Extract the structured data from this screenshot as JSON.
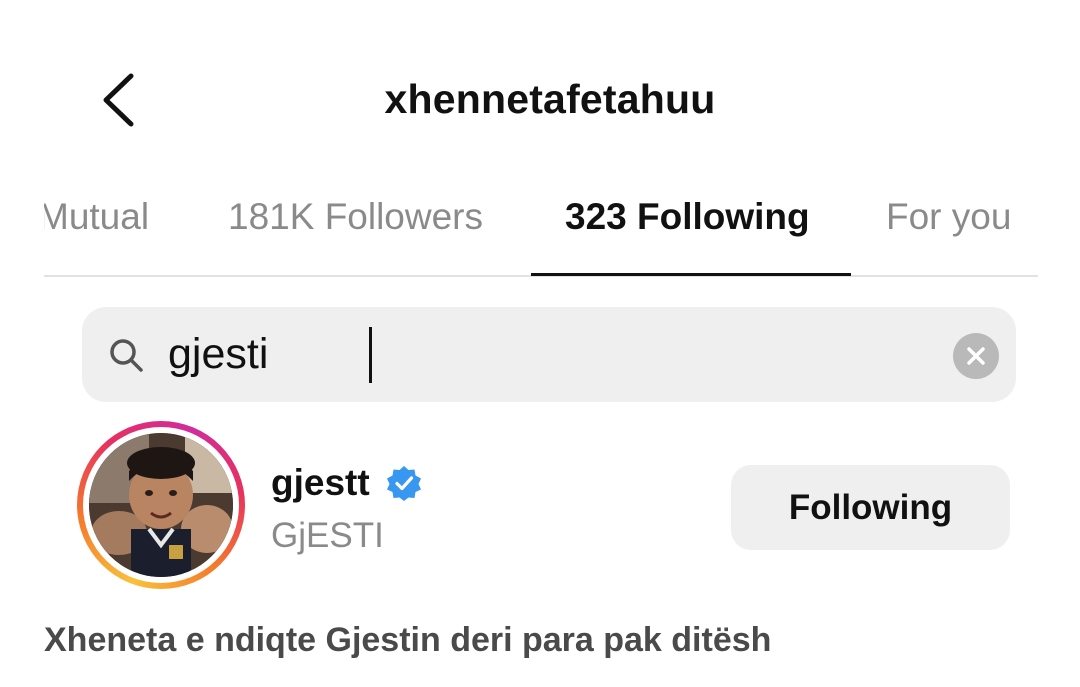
{
  "header": {
    "title": "xhennetafetahuu",
    "back_icon": "chevron-left-icon"
  },
  "tabs": [
    {
      "label": "Mutual",
      "active": false
    },
    {
      "label": "181K Followers",
      "active": false
    },
    {
      "label": "323 Following",
      "active": true
    },
    {
      "label": "For you",
      "active": false
    }
  ],
  "search": {
    "value": "gjesti",
    "icon": "search-icon",
    "clear_icon": "clear-icon"
  },
  "result": {
    "username": "gjestt",
    "verified": true,
    "full_name": "GjESTI",
    "button_label": "Following",
    "story_ring": true
  },
  "caption": "Xheneta e ndiqte Gjestin deri para pak ditësh",
  "colors": {
    "text_primary": "#111111",
    "text_secondary": "#8a8a8a",
    "verified_blue": "#3897f0",
    "button_bg": "#efefef",
    "caption": "#4a4a4a"
  }
}
